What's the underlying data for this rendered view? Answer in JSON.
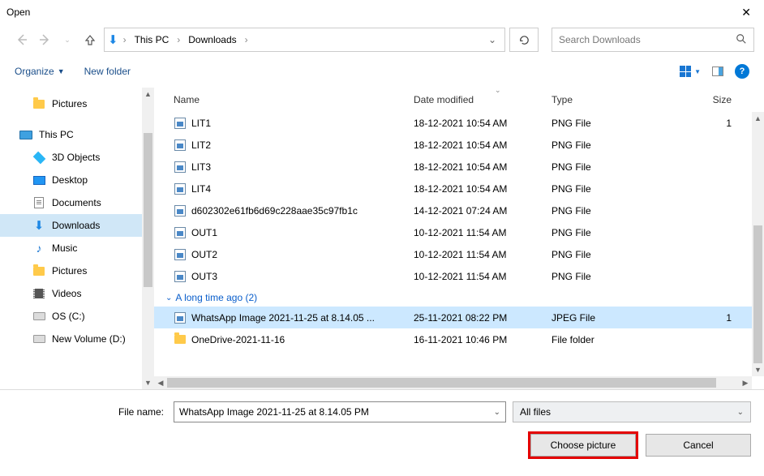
{
  "window": {
    "title": "Open"
  },
  "breadcrumb": {
    "segment1": "This PC",
    "segment2": "Downloads"
  },
  "search": {
    "placeholder": "Search Downloads"
  },
  "toolbar": {
    "organize": "Organize",
    "newfolder": "New folder"
  },
  "sidebar": {
    "items": [
      {
        "label": "Pictures",
        "icon": "folder"
      },
      {
        "label": "This PC",
        "icon": "pc",
        "root": true
      },
      {
        "label": "3D Objects",
        "icon": "obj3d"
      },
      {
        "label": "Desktop",
        "icon": "desktop"
      },
      {
        "label": "Documents",
        "icon": "doc"
      },
      {
        "label": "Downloads",
        "icon": "download",
        "selected": true
      },
      {
        "label": "Music",
        "icon": "music"
      },
      {
        "label": "Pictures",
        "icon": "folder"
      },
      {
        "label": "Videos",
        "icon": "video"
      },
      {
        "label": "OS (C:)",
        "icon": "drive"
      },
      {
        "label": "New Volume (D:)",
        "icon": "drive"
      }
    ]
  },
  "columns": {
    "name": "Name",
    "date": "Date modified",
    "type": "Type",
    "size": "Size"
  },
  "files": [
    {
      "name": "LIT1",
      "date": "18-12-2021 10:54 AM",
      "type": "PNG File",
      "size": "1",
      "icon": "img"
    },
    {
      "name": "LIT2",
      "date": "18-12-2021 10:54 AM",
      "type": "PNG File",
      "size": "",
      "icon": "img"
    },
    {
      "name": "LIT3",
      "date": "18-12-2021 10:54 AM",
      "type": "PNG File",
      "size": "",
      "icon": "img"
    },
    {
      "name": "LIT4",
      "date": "18-12-2021 10:54 AM",
      "type": "PNG File",
      "size": "",
      "icon": "img"
    },
    {
      "name": "d602302e61fb6d69c228aae35c97fb1c",
      "date": "14-12-2021 07:24 AM",
      "type": "PNG File",
      "size": "",
      "icon": "img"
    },
    {
      "name": "OUT1",
      "date": "10-12-2021 11:54 AM",
      "type": "PNG File",
      "size": "",
      "icon": "img"
    },
    {
      "name": "OUT2",
      "date": "10-12-2021 11:54 AM",
      "type": "PNG File",
      "size": "",
      "icon": "img"
    },
    {
      "name": "OUT3",
      "date": "10-12-2021 11:54 AM",
      "type": "PNG File",
      "size": "",
      "icon": "img"
    }
  ],
  "group": {
    "label": "A long time ago (2)"
  },
  "files_group": [
    {
      "name": "WhatsApp Image 2021-11-25 at 8.14.05 ...",
      "date": "25-11-2021 08:22 PM",
      "type": "JPEG File",
      "size": "1",
      "icon": "img",
      "selected": true
    },
    {
      "name": "OneDrive-2021-11-16",
      "date": "16-11-2021 10:46 PM",
      "type": "File folder",
      "size": "",
      "icon": "folder"
    }
  ],
  "filename": {
    "label": "File name:",
    "value": "WhatsApp Image 2021-11-25 at 8.14.05 PM"
  },
  "filter": {
    "value": "All files"
  },
  "buttons": {
    "confirm": "Choose picture",
    "cancel": "Cancel"
  }
}
